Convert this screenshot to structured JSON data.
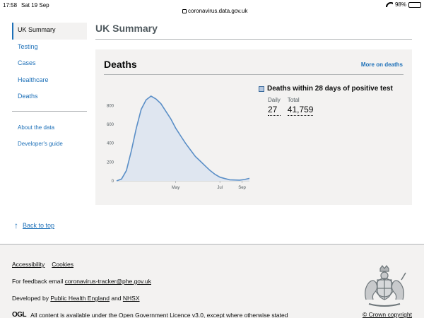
{
  "status_bar": {
    "time": "17:58",
    "date": "Sat 19 Sep",
    "url": "coronavirus.data.gov.uk",
    "battery": "98%"
  },
  "sidebar": {
    "items": [
      {
        "label": "UK Summary",
        "active": true
      },
      {
        "label": "Testing"
      },
      {
        "label": "Cases"
      },
      {
        "label": "Healthcare"
      },
      {
        "label": "Deaths"
      }
    ],
    "secondary": [
      {
        "label": "About the data"
      },
      {
        "label": "Developer's guide"
      }
    ]
  },
  "page": {
    "title": "UK Summary"
  },
  "panel": {
    "title": "Deaths",
    "more_link": "More on deaths",
    "metric_title": "Deaths within 28 days of positive test",
    "daily_label": "Daily",
    "daily_value": "27",
    "total_label": "Total",
    "total_value": "41,759"
  },
  "chart_data": {
    "type": "area",
    "x_ticks": [
      "May",
      "Jul",
      "Sep"
    ],
    "y_ticks": [
      "0",
      "200",
      "400",
      "600",
      "800"
    ],
    "ylim": [
      0,
      900
    ],
    "color": "#5b8fc7",
    "fill": "#dfe6f0",
    "x": [
      "Mar 10",
      "Mar 20",
      "Mar 25",
      "Mar 30",
      "Apr 3",
      "Apr 6",
      "Apr 8",
      "Apr 10",
      "Apr 14",
      "Apr 18",
      "Apr 22",
      "Apr 26",
      "May 1",
      "May 5",
      "May 10",
      "May 15",
      "May 20",
      "May 25",
      "Jun 1",
      "Jun 10",
      "Jun 20",
      "Jul 1",
      "Jul 15",
      "Aug 1",
      "Aug 15",
      "Sep 1",
      "Sep 12",
      "Sep 19"
    ],
    "values": [
      0,
      20,
      110,
      320,
      560,
      760,
      860,
      900,
      870,
      820,
      740,
      660,
      560,
      480,
      400,
      330,
      260,
      210,
      160,
      110,
      70,
      40,
      25,
      12,
      10,
      8,
      15,
      27
    ]
  },
  "back_to_top": "Back to top",
  "footer": {
    "accessibility": "Accessibility",
    "cookies": "Cookies",
    "feedback_prefix": "For feedback email ",
    "feedback_email": "coronavirus-tracker@phe.gov.uk",
    "developed_prefix": "Developed by ",
    "phe": "Public Health England",
    "and": " and ",
    "nhsx": "NHSX",
    "ogl_logo": "OGL",
    "licence_prefix": "All content is available under the ",
    "licence_link": "Open Government Licence v3.0",
    "licence_suffix": ", except where otherwise stated",
    "copyright": "© Crown copyright"
  }
}
